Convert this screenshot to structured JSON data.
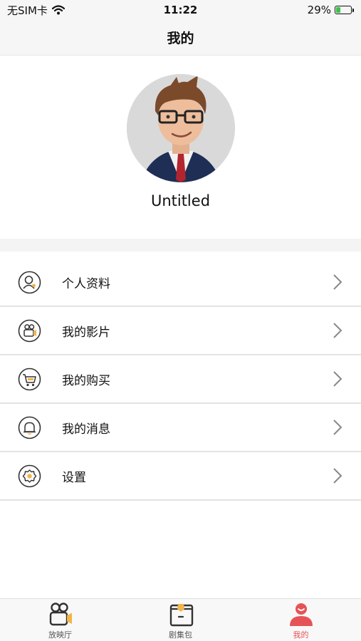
{
  "status_bar": {
    "carrier": "无SIM卡",
    "time": "11:22",
    "battery": "29%",
    "battery_level": 0.29
  },
  "nav": {
    "title": "我的"
  },
  "profile": {
    "username": "Untitled"
  },
  "menu": [
    {
      "label": "个人资料",
      "icon": "profile-icon"
    },
    {
      "label": "我的影片",
      "icon": "camera-icon"
    },
    {
      "label": "我的购买",
      "icon": "cart-icon"
    },
    {
      "label": "我的消息",
      "icon": "bell-icon"
    },
    {
      "label": "设置",
      "icon": "gear-icon"
    }
  ],
  "tabs": [
    {
      "label": "放映厅",
      "icon": "projector-icon",
      "active": false
    },
    {
      "label": "剧集包",
      "icon": "box-icon",
      "active": false
    },
    {
      "label": "我的",
      "icon": "user-icon",
      "active": true
    }
  ],
  "colors": {
    "accent": "#e65356",
    "icon_accent": "#f0b64a",
    "icon_stroke": "#333333"
  }
}
